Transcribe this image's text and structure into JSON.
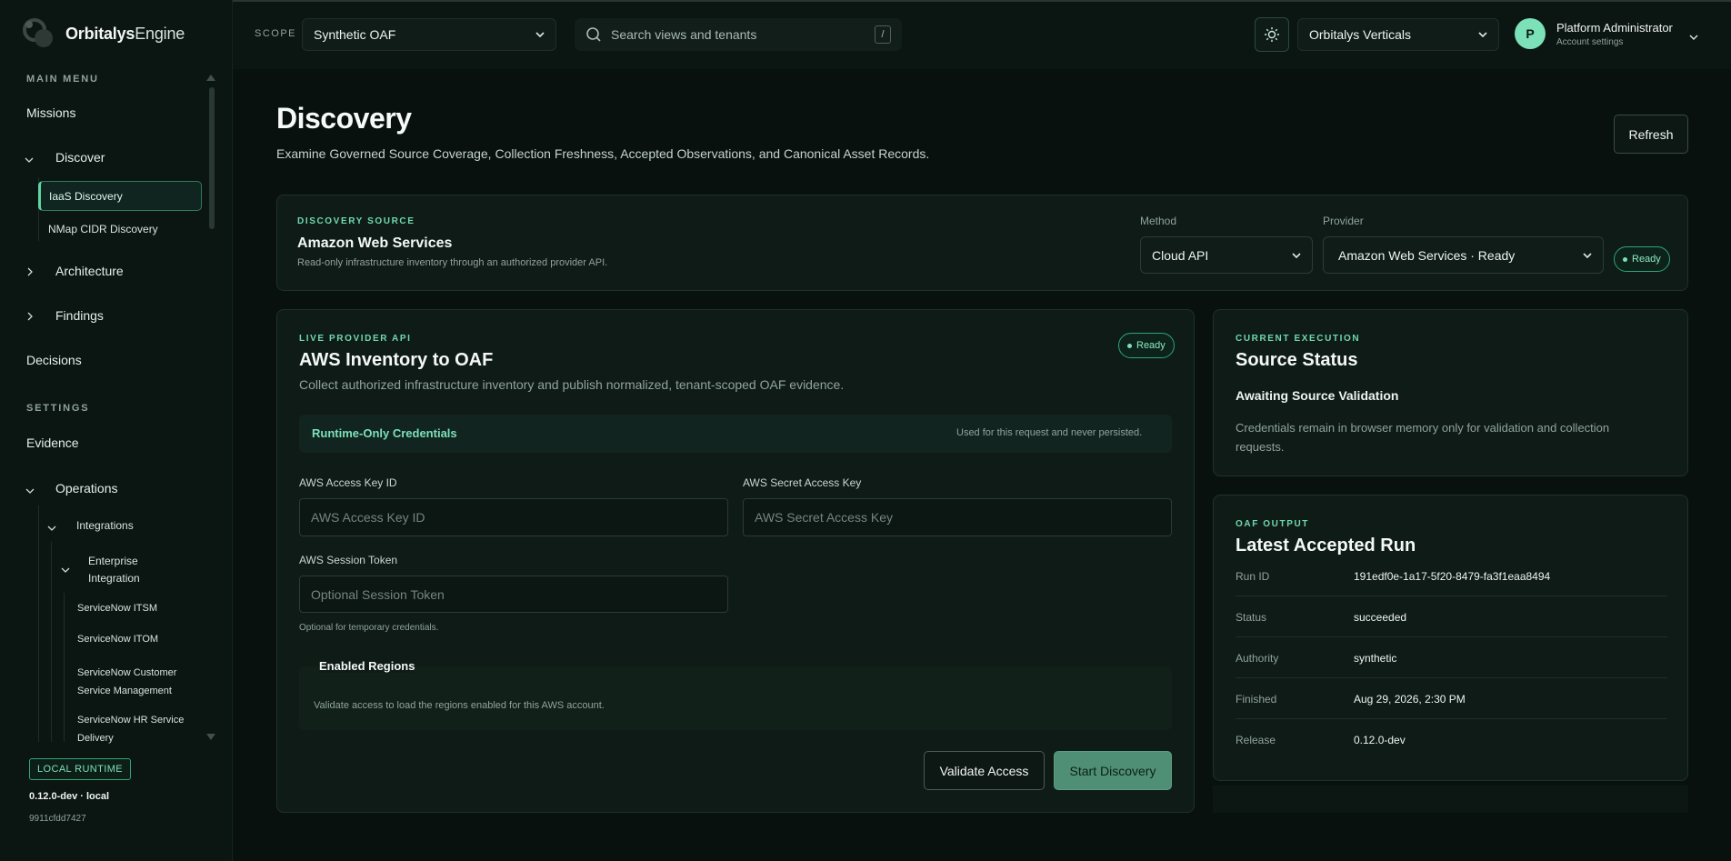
{
  "brand": {
    "name_bold": "Orbitalys",
    "name_light": "Engine"
  },
  "header": {
    "scope_label": "SCOPE",
    "scope_value": "Synthetic OAF",
    "search_placeholder": "Search views and tenants",
    "search_shortcut": "/",
    "tenant_value": "Orbitalys Verticals",
    "user": {
      "avatar_letter": "P",
      "name": "Platform Administrator",
      "subtitle": "Account settings"
    }
  },
  "sidebar": {
    "main_menu_label": "MAIN MENU",
    "missions": "Missions",
    "discover": "Discover",
    "iaas_discovery": "IaaS Discovery",
    "nmap_discovery": "NMap CIDR Discovery",
    "architecture": "Architecture",
    "findings": "Findings",
    "decisions": "Decisions",
    "settings_label": "SETTINGS",
    "evidence": "Evidence",
    "operations": "Operations",
    "integrations": "Integrations",
    "enterprise_integration_1": "Enterprise",
    "enterprise_integration_2": "Integration",
    "sn_itsm": "ServiceNow ITSM",
    "sn_itom": "ServiceNow ITOM",
    "sn_csm_1": "ServiceNow Customer",
    "sn_csm_2": "Service Management",
    "sn_hr_1": "ServiceNow HR Service",
    "sn_hr_2": "Delivery",
    "runtime_badge": "LOCAL RUNTIME",
    "runtime_version": "0.12.0-dev · local",
    "runtime_hash": "9911cfdd7427"
  },
  "page": {
    "title": "Discovery",
    "subtitle": "Examine Governed Source Coverage, Collection Freshness, Accepted Observations, and Canonical Asset Records.",
    "refresh": "Refresh"
  },
  "source_card": {
    "eyebrow": "DISCOVERY SOURCE",
    "title": "Amazon Web Services",
    "description": "Read-only infrastructure inventory through an authorized provider API.",
    "method_label": "Method",
    "method_value": "Cloud API",
    "provider_label": "Provider",
    "provider_value": "Amazon Web Services · Ready",
    "status": "Ready"
  },
  "aws_card": {
    "eyebrow": "LIVE PROVIDER API",
    "title": "AWS Inventory to OAF",
    "status": "Ready",
    "description": "Collect authorized infrastructure inventory and publish normalized, tenant-scoped OAF evidence.",
    "credentials_title": "Runtime-Only Credentials",
    "credentials_note": "Used for this request and never persisted.",
    "access_key_label": "AWS Access Key ID",
    "access_key_placeholder": "AWS Access Key ID",
    "secret_key_label": "AWS Secret Access Key",
    "secret_key_placeholder": "AWS Secret Access Key",
    "session_token_label": "AWS Session Token",
    "session_token_placeholder": "Optional Session Token",
    "session_token_hint": "Optional for temporary credentials.",
    "regions_title": "Enabled Regions",
    "regions_note": "Validate access to load the regions enabled for this AWS account.",
    "validate_button": "Validate Access",
    "start_button": "Start Discovery"
  },
  "status_card": {
    "eyebrow": "CURRENT EXECUTION",
    "title": "Source Status",
    "state": "Awaiting Source Validation",
    "description_1": "Credentials remain in browser memory only for validation and collection",
    "description_2": "requests."
  },
  "output_card": {
    "eyebrow": "OAF OUTPUT",
    "title": "Latest Accepted Run",
    "rows": [
      {
        "label": "Run ID",
        "value": "191edf0e-1a17-5f20-8479-fa3f1eaa8494"
      },
      {
        "label": "Status",
        "value": "succeeded"
      },
      {
        "label": "Authority",
        "value": "synthetic"
      },
      {
        "label": "Finished",
        "value": "Aug 29, 2026, 2:30 PM"
      },
      {
        "label": "Release",
        "value": "0.12.0-dev"
      }
    ]
  },
  "colors": {
    "accent": "#7ce0b8",
    "background": "#08110e",
    "card": "#0f1b17"
  }
}
